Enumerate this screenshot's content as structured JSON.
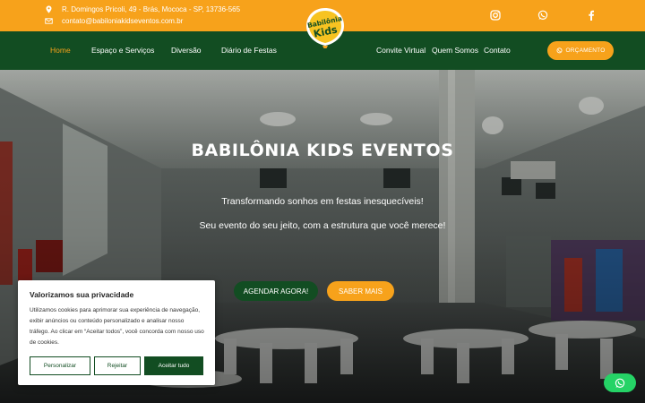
{
  "topbar": {
    "address": "R. Domingos Pricoli, 49 - Brás, Mococa - SP, 13736-565",
    "email": "contato@babiloniakidseventos.com.br",
    "address_icon": "map-pin-icon",
    "email_icon": "envelope-icon",
    "social": [
      {
        "icon": "instagram-icon"
      },
      {
        "icon": "whatsapp-icon"
      },
      {
        "icon": "facebook-icon"
      }
    ]
  },
  "logo": {
    "line1": "Babilônia",
    "line2": "Kids"
  },
  "nav": {
    "items_left": [
      "Home",
      "Espaço e Serviços",
      "Diversão",
      "Diário de Festas"
    ],
    "items_right": [
      "Convite Virtual",
      "Quem Somos",
      "Contato"
    ],
    "active": "Home",
    "orcamento_label": "ORÇAMENTO"
  },
  "hero": {
    "title": "BABILÔNIA KIDS EVENTOS",
    "subtitle1": "Transformando sonhos em festas inesquecíveis!",
    "subtitle2": "Seu evento do seu jeito, com a estrutura que você merece!",
    "primary_button": "AGENDAR AGORA!",
    "secondary_button": "SABER MAIS"
  },
  "cookie": {
    "title": "Valorizamos sua privacidade",
    "text": "Utilizamos cookies para aprimorar sua experiência de navegação, exibir anúncios ou conteúdo personalizado e analisar nosso tráfego. Ao clicar em “Aceitar todos”, você concorda com nosso uso de cookies.",
    "btn_customize": "Personalizar",
    "btn_reject": "Rejeitar",
    "btn_accept": "Aceitar tudo"
  },
  "colors": {
    "orange": "#f7a21b",
    "green": "#124d22",
    "whatsapp": "#25d366"
  }
}
